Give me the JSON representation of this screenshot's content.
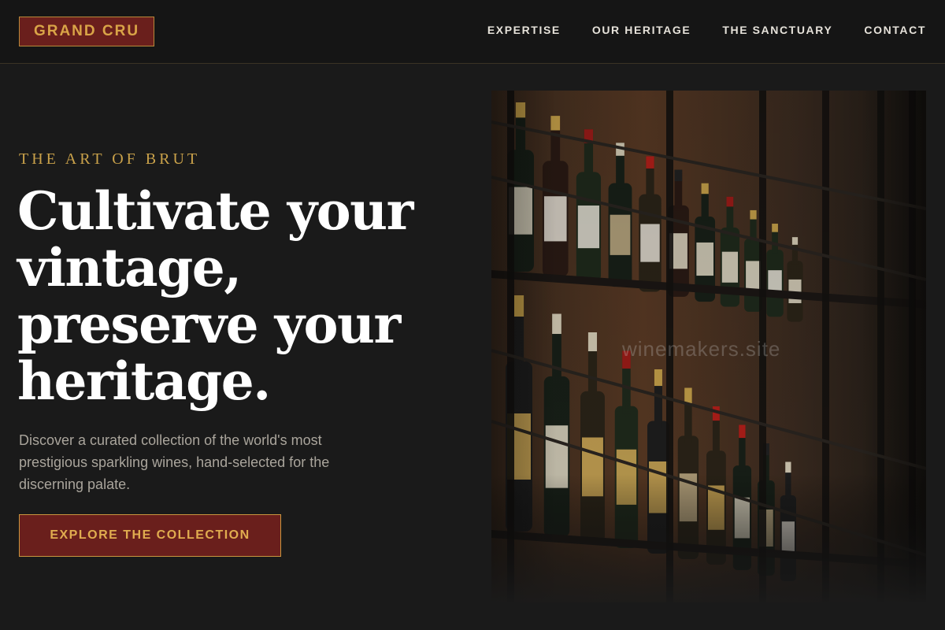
{
  "brand": {
    "logo_text": "GRAND CRU"
  },
  "nav": {
    "items": [
      {
        "label": "EXPERTISE"
      },
      {
        "label": "OUR HERITAGE"
      },
      {
        "label": "THE SANCTUARY"
      },
      {
        "label": "CONTACT"
      }
    ]
  },
  "hero": {
    "eyebrow": "THE ART OF BRUT",
    "headline_lines": [
      "Cultivate your",
      "vintage,",
      "preserve your",
      "heritage."
    ],
    "description": "Discover a curated collection of the world's most prestigious sparkling wines, hand-selected for the discerning palate.",
    "cta_label": "EXPLORE THE COLLECTION",
    "image_watermark": "winemakers.site"
  },
  "colors": {
    "background": "#1a1a1a",
    "header_background": "#151515",
    "accent_gold": "#c9a14a",
    "brand_burgundy": "#6a1f1c",
    "headline": "#ffffff",
    "body_text": "#aaa59c"
  }
}
